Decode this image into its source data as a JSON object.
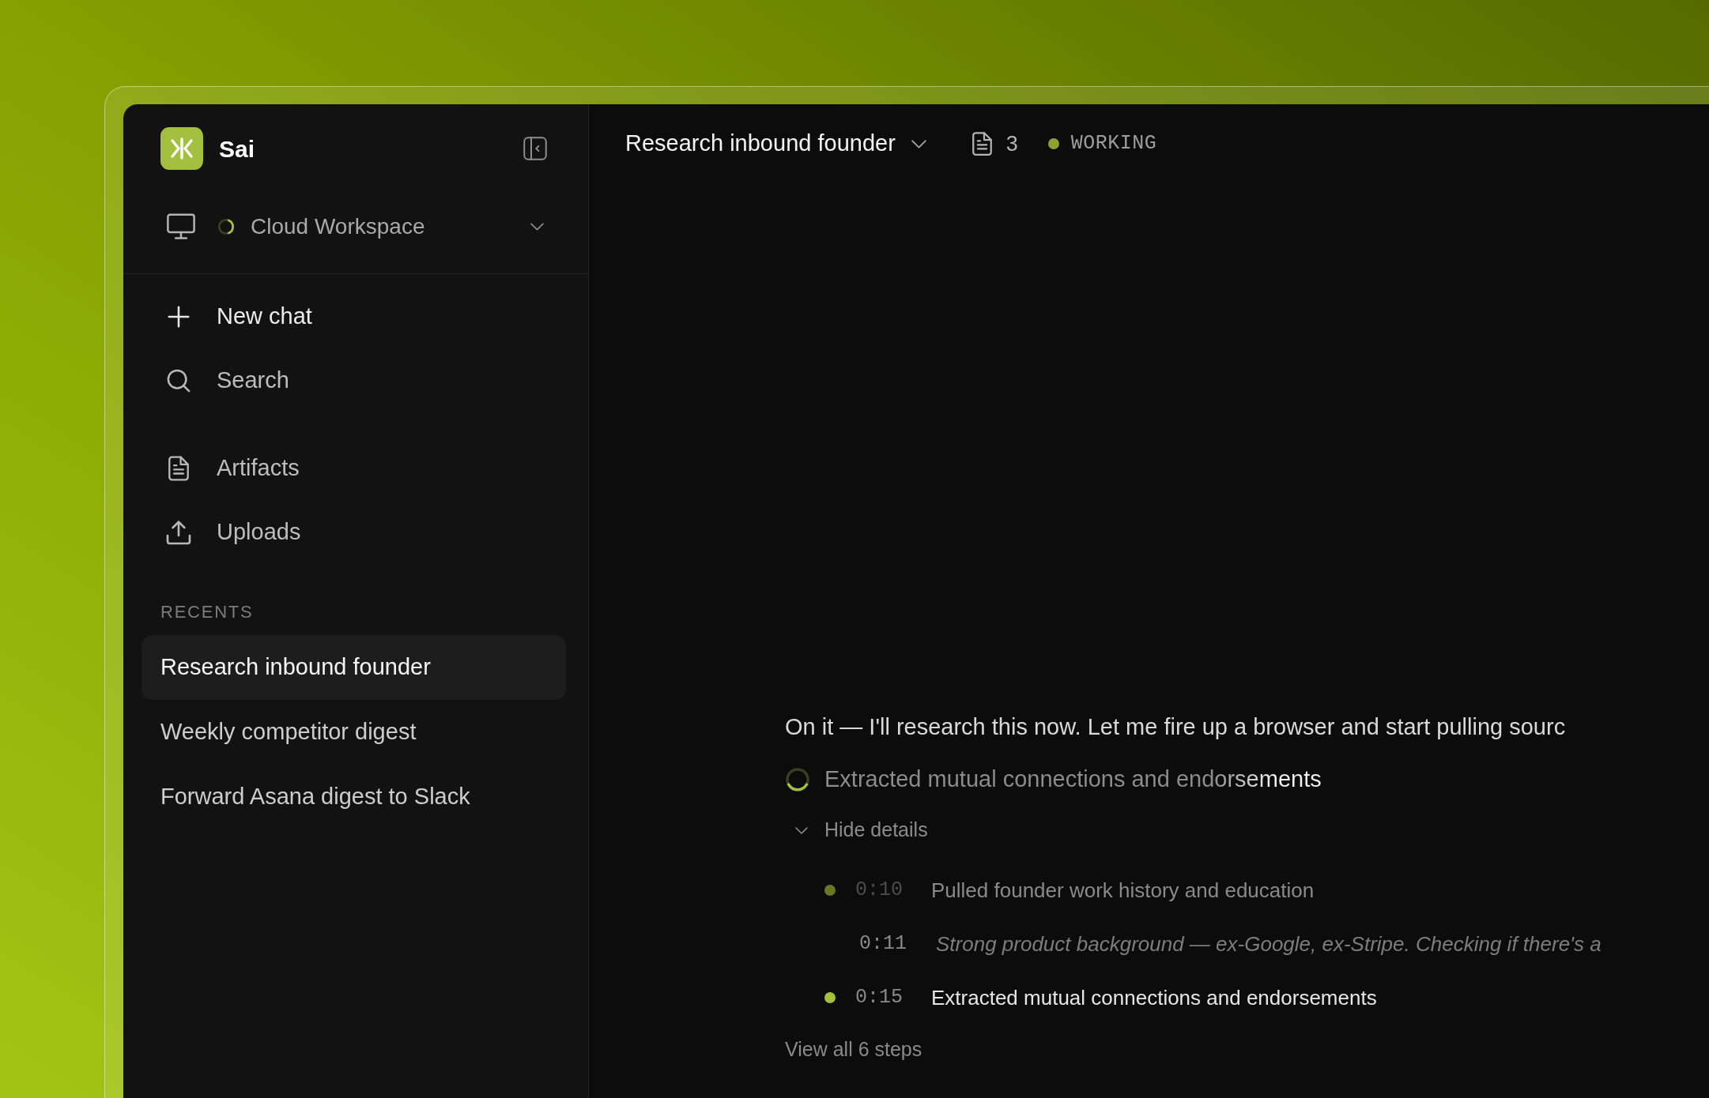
{
  "app": {
    "name": "Sai"
  },
  "sidebar": {
    "workspace": {
      "label": "Cloud Workspace"
    },
    "actions": [
      {
        "kind": "new",
        "label": "New chat"
      },
      {
        "kind": "search",
        "label": "Search"
      }
    ],
    "sections": [
      {
        "kind": "artifacts",
        "label": "Artifacts"
      },
      {
        "kind": "uploads",
        "label": "Uploads"
      }
    ],
    "recents": {
      "heading": "RECENTS",
      "items": [
        {
          "label": "Research inbound founder",
          "selected": true
        },
        {
          "label": "Weekly competitor digest",
          "selected": false
        },
        {
          "label": "Forward Asana digest to Slack",
          "selected": false
        }
      ]
    }
  },
  "header": {
    "title": "Research inbound founder",
    "artifact_count": "3",
    "status": "WORKING"
  },
  "conversation": {
    "message": "On it — I'll research this now. Let me fire up a browser and start pulling sourc",
    "progress": {
      "label": "Extracted mutual connections and endorsements"
    },
    "details": {
      "label": "Hide details",
      "expanded": true
    },
    "steps": [
      {
        "kind": "step",
        "time": "0:10",
        "text": "Pulled founder work history and education",
        "active": false
      },
      {
        "kind": "note",
        "time": "0:11",
        "text": "Strong product background — ex-Google, ex-Stripe. Checking if there's a"
      },
      {
        "kind": "step",
        "time": "0:15",
        "text": "Extracted mutual connections and endorsements",
        "active": true
      }
    ],
    "view_all": "View all 6 steps"
  }
}
